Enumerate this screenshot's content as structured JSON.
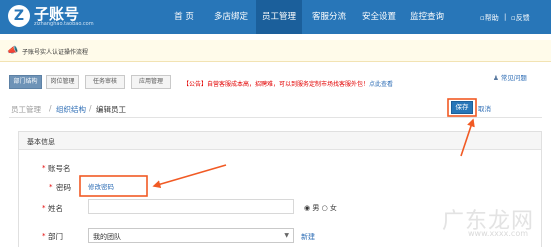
{
  "header": {
    "logo": {
      "mark": "Z",
      "title": "子账号",
      "subtitle": "zizhanghao.taobao.com"
    },
    "nav": [
      "首 页",
      "多店绑定",
      "员工管理",
      "客服分流",
      "安全设置",
      "监控查询"
    ],
    "active_nav": "员工管理",
    "help_link": "帮助",
    "feedback_link": "反馈"
  },
  "notice": {
    "icon": "megaphone-icon",
    "text": "子账号实人认证操作流程"
  },
  "tabs": [
    {
      "label": "部门结构",
      "active": true
    },
    {
      "label": "岗位管理",
      "active": false
    },
    {
      "label": "任务审核",
      "active": false
    },
    {
      "label": "应用管理",
      "active": false
    }
  ],
  "announcement": {
    "text": "【公告】自营客服成本高，招聘难，可以到服务定制市场找客服外包！",
    "link": "点此查看"
  },
  "help": {
    "icon": "user-help-icon",
    "label": "常见问题"
  },
  "breadcrumb": {
    "root": "员工管理",
    "middle": "组织结构",
    "current": "编辑员工",
    "separator": "/"
  },
  "actions": {
    "save_label": "保存",
    "cancel_label": "取消"
  },
  "form": {
    "section_title": "基本信息",
    "required_mark": "*",
    "account_label": "账号名",
    "password_label": "密码",
    "password_link": "修改密码",
    "name_label": "姓名",
    "gender": {
      "male": "男",
      "female": "女",
      "selected": "男"
    },
    "department_label": "部门",
    "department_value": "我的团队",
    "new_link": "新建"
  },
  "colors": {
    "brand": "#2876b8",
    "annotation": "#f15a24",
    "required": "#e30000",
    "link": "#2d6db5"
  },
  "watermark": {
    "text": "广东龙网",
    "domain": "www.xxxx.com"
  }
}
